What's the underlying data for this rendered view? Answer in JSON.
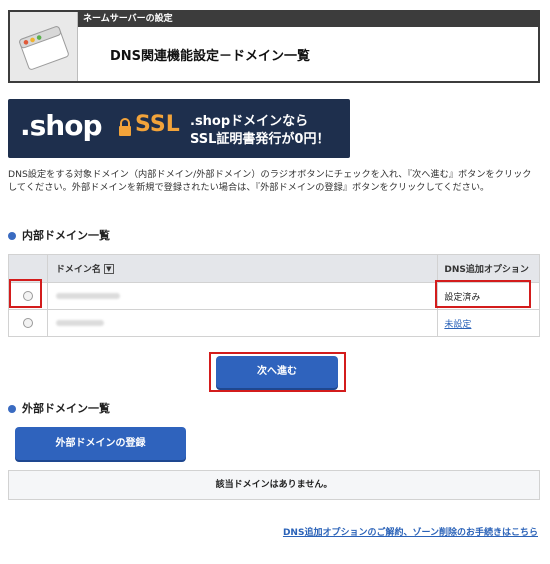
{
  "header": {
    "section": "ネームサーバーの設定",
    "title": "DNS関連機能設定－ドメイン一覧"
  },
  "banner": {
    "brand": ".shop",
    "ssl": "SSL",
    "line1": ".shopドメインなら",
    "line2": "SSL証明書発行が0円！",
    "colors": {
      "background": "#1e2f4d",
      "accent": "#f2a33a"
    }
  },
  "description": "DNS設定をする対象ドメイン（内部ドメイン/外部ドメイン）のラジオボタンにチェックを入れ、『次へ進む』ボタンをクリックしてください。外部ドメインを新規で登録されたい場合は、『外部ドメインの登録』ボタンをクリックしてください。",
  "internal": {
    "title": "内部ドメイン一覧",
    "columns": {
      "domain": "ドメイン名",
      "option": "DNS追加オプション"
    },
    "rows": [
      {
        "domain": "",
        "status": "設定済み",
        "status_is_link": false
      },
      {
        "domain": "",
        "status": "未設定",
        "status_is_link": true
      }
    ]
  },
  "next_button": "次へ進む",
  "external": {
    "title": "外部ドメイン一覧",
    "register_button": "外部ドメインの登録",
    "empty_message": "該当ドメインはありません。"
  },
  "footer_link": "DNS追加オプションのご解約、ゾーン削除のお手続きはこちら",
  "colors": {
    "primary": "#2f63bd",
    "highlight": "#d31c1c",
    "link": "#2a62b8"
  }
}
